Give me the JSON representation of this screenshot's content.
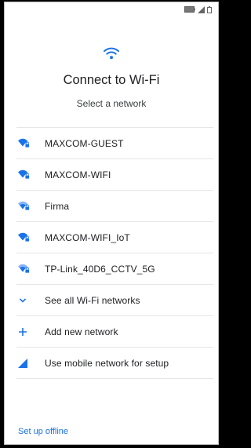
{
  "status_bar": {
    "icons": [
      "battery-icon",
      "signal-icon",
      "battery-outline-icon"
    ]
  },
  "header": {
    "title": "Connect to Wi-Fi",
    "subtitle": "Select a network"
  },
  "networks": [
    {
      "name": "MAXCOM-GUEST",
      "icon": "wifi-locked-icon"
    },
    {
      "name": "MAXCOM-WIFI",
      "icon": "wifi-locked-icon"
    },
    {
      "name": "Firma",
      "icon": "wifi-locked-icon"
    },
    {
      "name": "MAXCOM-WIFI_IoT",
      "icon": "wifi-locked-icon"
    },
    {
      "name": "TP-Link_40D6_CCTV_5G",
      "icon": "wifi-locked-icon"
    }
  ],
  "actions": {
    "see_all": "See all Wi-Fi networks",
    "add_network": "Add new network",
    "mobile_setup": "Use mobile network for setup"
  },
  "footer": {
    "offline": "Set up offline"
  },
  "colors": {
    "accent": "#1a73e8",
    "text": "#202124"
  }
}
